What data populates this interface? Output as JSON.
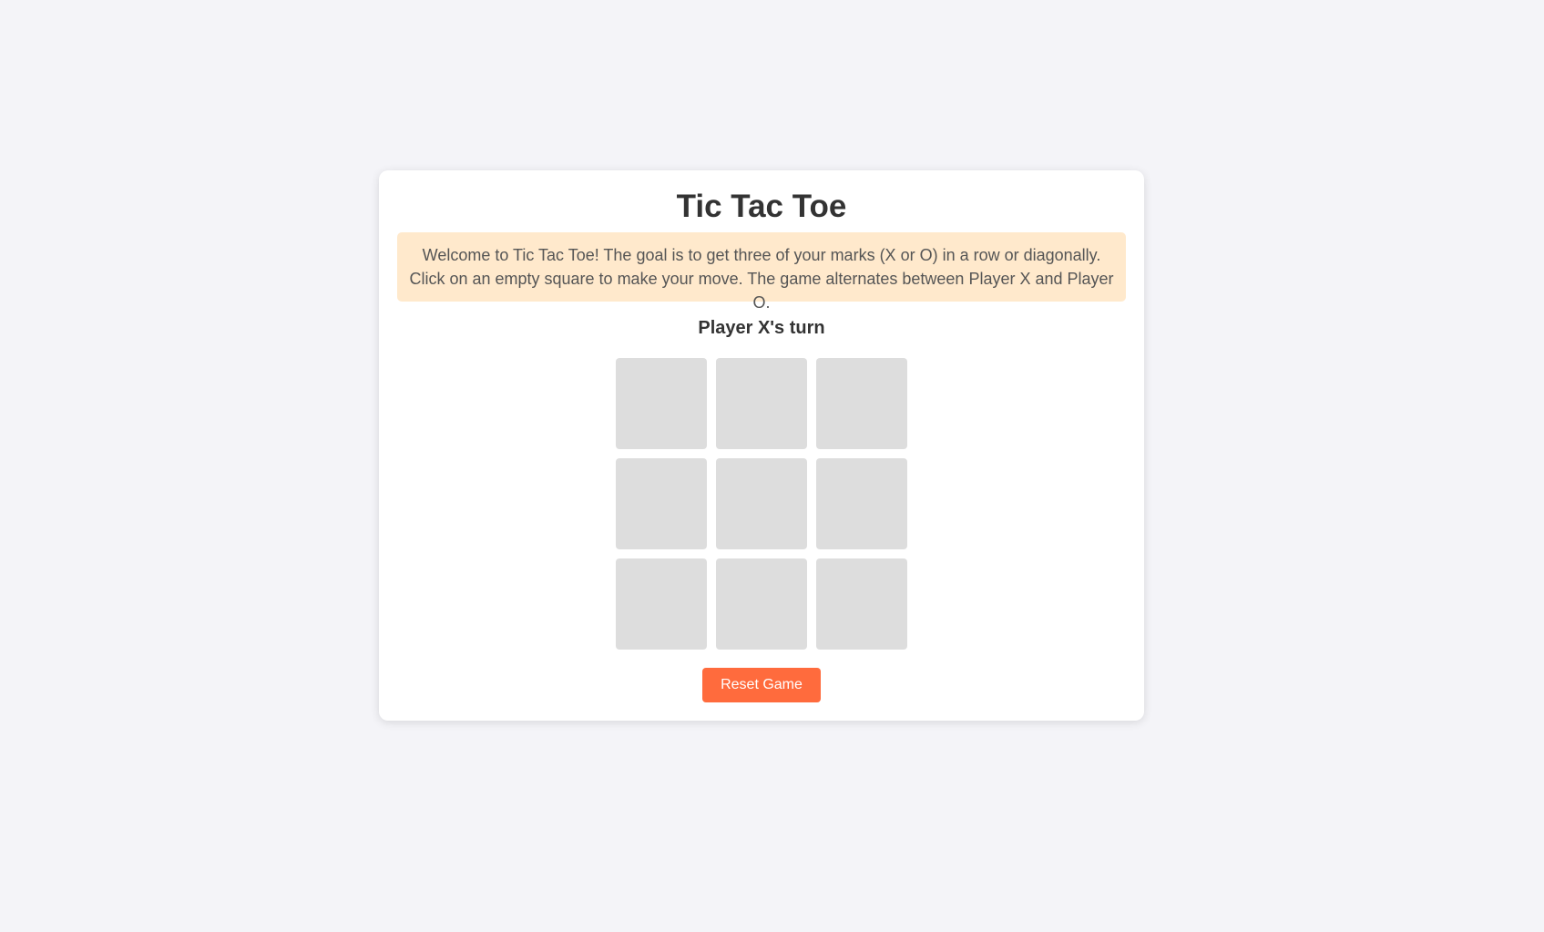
{
  "game": {
    "title": "Tic Tac Toe",
    "instructions": [
      "Welcome to Tic Tac Toe! The goal is to get three of your marks (X or O) in a row or diagonally.",
      "Click on an empty square to make your move. The game alternates between Player X and Player O."
    ],
    "status": "Player X's turn",
    "board": [
      "",
      "",
      "",
      "",
      "",
      "",
      "",
      "",
      ""
    ],
    "reset_label": "Reset Game"
  },
  "colors": {
    "page_background": "#f4f4f8",
    "card_background": "#ffffff",
    "instructions_background": "#ffe9cc",
    "cell_background": "#dddddd",
    "reset_button": "#ff6b3d"
  }
}
